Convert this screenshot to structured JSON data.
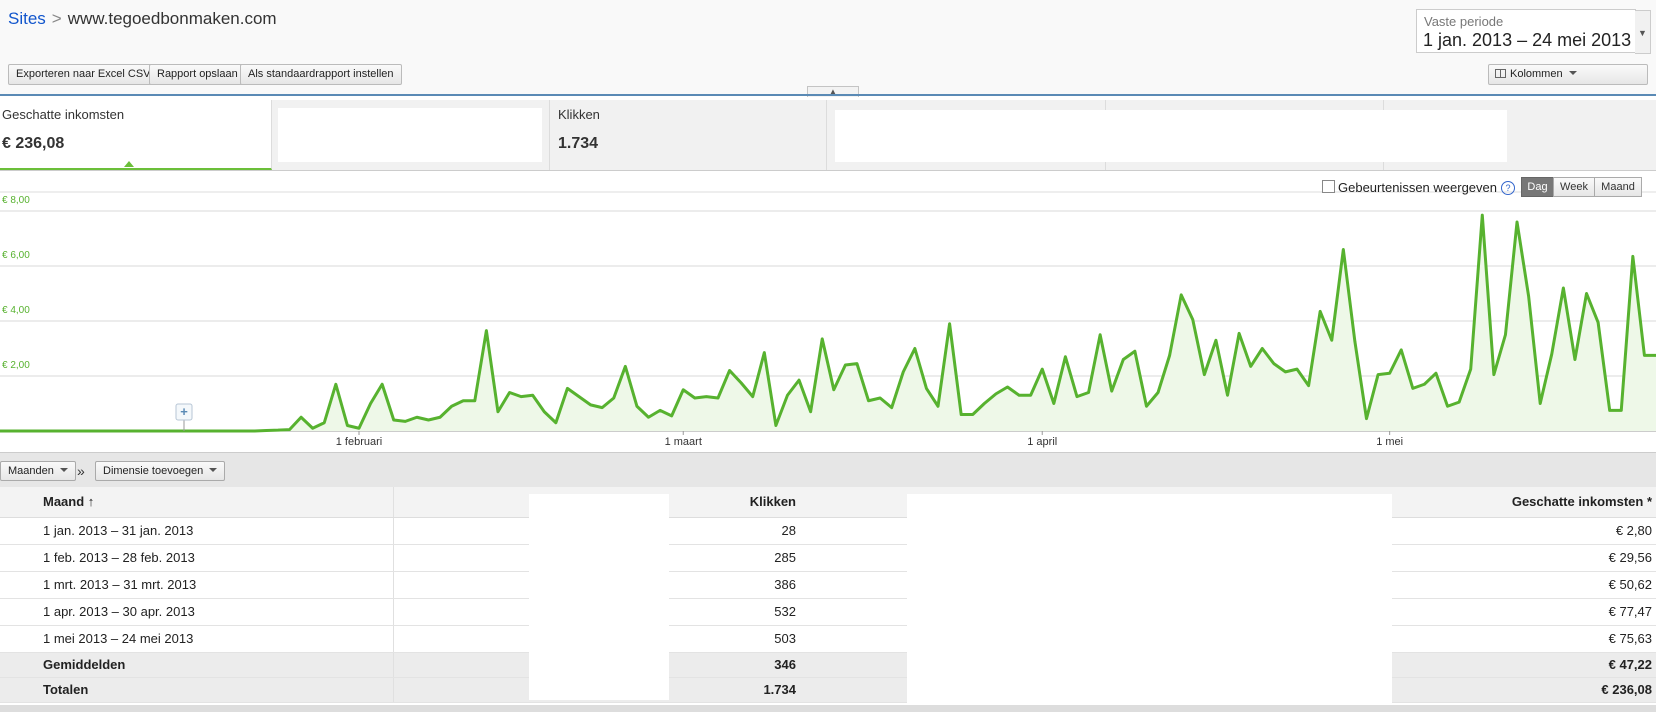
{
  "breadcrumb": {
    "root": "Sites",
    "separator": ">",
    "site": "www.tegoedbonmaken.com"
  },
  "date_picker": {
    "label": "Vaste periode",
    "range": "1 jan. 2013 – 24 mei 2013"
  },
  "toolbar": {
    "export": "Exporteren naar Excel CSV",
    "save": "Rapport opslaan",
    "default": "Als standaardrapport instellen",
    "columns": "Kolommen"
  },
  "scorecards": [
    {
      "title": "Geschatte inkomsten",
      "value": "€ 236,08"
    },
    {
      "title": "",
      "value": ""
    },
    {
      "title": "Klikken",
      "value": "1.734"
    }
  ],
  "chart_controls": {
    "events_label": "Gebeurtenissen weergeven",
    "help": "?",
    "day": "Dag",
    "week": "Week",
    "month": "Maand"
  },
  "chart_data": {
    "type": "area",
    "accent_color": "#57b22f",
    "fill_color": "#eef8e8",
    "x_start": "2013-01-01",
    "x_end": "2013-05-24",
    "ylim": [
      0,
      8
    ],
    "y_ticks": [
      2,
      4,
      6,
      8
    ],
    "y_tick_labels": [
      "€ 2,00",
      "€ 4,00",
      "€ 6,00",
      "€ 8,00"
    ],
    "x_tick_labels": [
      {
        "label": "1 februari",
        "date": "2013-02-01"
      },
      {
        "label": "1 maart",
        "date": "2013-03-01"
      },
      {
        "label": "1 april",
        "date": "2013-04-01"
      },
      {
        "label": "1 mei",
        "date": "2013-05-01"
      }
    ],
    "values": [
      0,
      0,
      0,
      0,
      0,
      0,
      0,
      0,
      0,
      0,
      0,
      0,
      0,
      0,
      0,
      0,
      0,
      0,
      0,
      0,
      0,
      0,
      0,
      0.02,
      0.03,
      0.05,
      0.5,
      0.1,
      0.3,
      1.7,
      0.2,
      0.1,
      1.0,
      1.7,
      0.4,
      0.35,
      0.5,
      0.4,
      0.5,
      0.9,
      1.1,
      1.1,
      3.65,
      0.7,
      1.4,
      1.25,
      1.3,
      0.7,
      0.3,
      1.55,
      1.25,
      0.95,
      0.85,
      1.2,
      2.35,
      0.9,
      0.5,
      0.75,
      0.55,
      1.5,
      1.2,
      1.25,
      1.2,
      2.2,
      1.75,
      1.25,
      2.85,
      0.2,
      1.3,
      1.85,
      0.7,
      3.35,
      1.5,
      2.4,
      2.45,
      1.1,
      1.2,
      0.85,
      2.15,
      3.0,
      1.55,
      0.9,
      3.9,
      0.6,
      0.6,
      1.0,
      1.35,
      1.6,
      1.3,
      1.3,
      2.25,
      1.0,
      2.7,
      1.25,
      1.4,
      3.5,
      1.45,
      2.6,
      2.9,
      0.9,
      1.4,
      2.75,
      4.95,
      4.05,
      2.05,
      3.3,
      1.3,
      3.55,
      2.35,
      3.0,
      2.45,
      2.15,
      2.25,
      1.65,
      4.35,
      3.3,
      6.6,
      3.25,
      0.45,
      2.05,
      2.1,
      2.95,
      1.55,
      1.7,
      2.1,
      0.9,
      1.05,
      2.25,
      7.85,
      2.05,
      3.5,
      7.6,
      4.9,
      1.0,
      2.8,
      5.2,
      2.6,
      5.0,
      3.95,
      0.75,
      0.75,
      6.35,
      2.75,
      2.75
    ]
  },
  "table_controls": {
    "months": "Maanden",
    "sep": "»",
    "add_dimension": "Dimensie toevoegen"
  },
  "table": {
    "headers": {
      "month": "Maand",
      "clicks": "Klikken",
      "income": "Geschatte inkomsten *"
    },
    "rows": [
      {
        "month": "1 jan. 2013 – 31 jan. 2013",
        "clicks": "28",
        "income": "€ 2,80"
      },
      {
        "month": "1 feb. 2013 – 28 feb. 2013",
        "clicks": "285",
        "income": "€ 29,56"
      },
      {
        "month": "1 mrt. 2013 – 31 mrt. 2013",
        "clicks": "386",
        "income": "€ 50,62"
      },
      {
        "month": "1 apr. 2013 – 30 apr. 2013",
        "clicks": "532",
        "income": "€ 77,47"
      },
      {
        "month": "1 mei 2013 – 24 mei 2013",
        "clicks": "503",
        "income": "€ 75,63"
      }
    ],
    "averages": {
      "label": "Gemiddelden",
      "clicks": "346",
      "income": "€ 47,22"
    },
    "totals": {
      "label": "Totalen",
      "clicks": "1.734",
      "income": "€ 236,08"
    }
  }
}
